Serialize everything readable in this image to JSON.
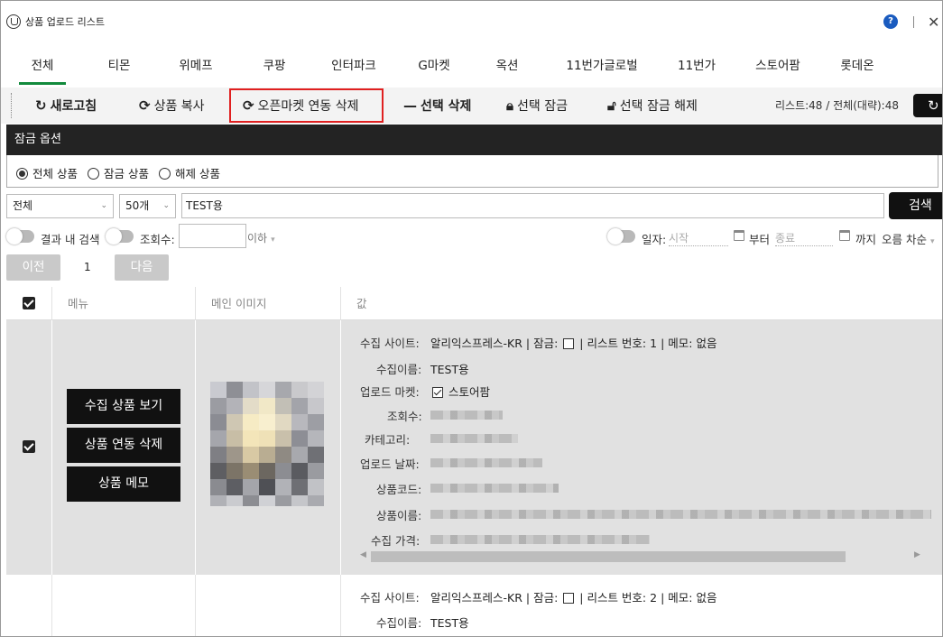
{
  "window": {
    "title": "상품 업로드 리스트",
    "help_symbol": "?"
  },
  "tabs": [
    {
      "label": "전체",
      "active": true
    },
    {
      "label": "티몬"
    },
    {
      "label": "위메프"
    },
    {
      "label": "쿠팡"
    },
    {
      "label": "인터파크"
    },
    {
      "label": "G마켓"
    },
    {
      "label": "옥션"
    },
    {
      "label": "11번가글로벌"
    },
    {
      "label": "11번가"
    },
    {
      "label": "스토어팜"
    },
    {
      "label": "롯데온"
    }
  ],
  "toolbar": {
    "refresh": "새로고침",
    "copy": "상품 복사",
    "openmarket_delete": "오픈마켓 연동 삭제",
    "delete_selected": "선택 삭제",
    "lock_selected": "선택 잠금",
    "unlock_selected": "선택 잠금 해제",
    "list_count_label": "리스트:48",
    "separator": "/",
    "total_count_label": "전체(대략):48",
    "highlight_color": "#e02020"
  },
  "lock_options": {
    "header": "잠금 옵션",
    "options": [
      "전체 상품",
      "잠금 상품",
      "해제 상품"
    ],
    "selected": "전체 상품"
  },
  "search": {
    "scope_value": "전체",
    "page_size_value": "50개",
    "query": "TEST용",
    "button": "검색"
  },
  "filters": {
    "in_result_label": "결과 내 검색",
    "views_label": "조회수:",
    "views_condition": "이하",
    "date_label": "일자:",
    "date_start_placeholder": "시작",
    "from_label": "부터",
    "date_end_placeholder": "종료",
    "until_label": "까지",
    "sort_label": "오름 차순"
  },
  "paging": {
    "prev": "이전",
    "current": "1",
    "next": "다음"
  },
  "table": {
    "columns": [
      "메뉴",
      "메인 이미지",
      "값"
    ],
    "row_actions": [
      "수집 상품 보기",
      "상품 연동 삭제",
      "상품 메모"
    ],
    "rows": [
      {
        "site_label": "수집 사이트:",
        "site": "알리익스프레스-KR",
        "lock_label": "| 잠금:",
        "list_no_label": "| 리스트 번호:",
        "list_no": "1",
        "memo_label": "| 메모:",
        "memo": "없음",
        "name_label": "수집이름:",
        "name": "TEST용",
        "market_label": "업로드 마켓:",
        "market": "스토어팜",
        "views_label": "조회수:",
        "category_label": "카테고리:",
        "upload_date_label": "업로드 날짜:",
        "code_label": "상품코드:",
        "product_name_label": "상품이름:",
        "price_label": "수집 가격:"
      },
      {
        "site_label": "수집 사이트:",
        "site": "알리익스프레스-KR",
        "lock_label": "| 잠금:",
        "list_no_label": "| 리스트 번호:",
        "list_no": "2",
        "memo_label": "| 메모:",
        "memo": "없음",
        "name_label": "수집이름:",
        "name": "TEST용"
      }
    ]
  },
  "colors": {
    "active_tab": "#128a3c",
    "dark": "#111111",
    "row_selected_bg": "#e1e1e1"
  }
}
